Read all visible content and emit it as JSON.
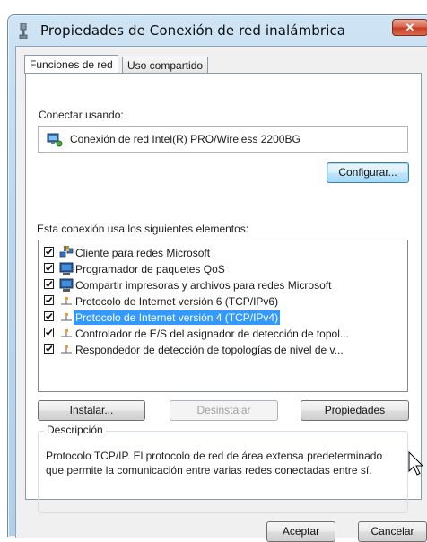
{
  "window": {
    "title": "Propiedades de Conexión de red inalámbrica",
    "close_label": "✕"
  },
  "tabs": [
    {
      "label": "Funciones de red",
      "active": true
    },
    {
      "label": "Uso compartido",
      "active": false
    }
  ],
  "connect_using": {
    "label": "Conectar usando:",
    "adapter": "Conexión de red Intel(R) PRO/Wireless 2200BG",
    "configure_button": "Configurar..."
  },
  "components": {
    "label": "Esta conexión usa los siguientes elementos:",
    "items": [
      {
        "label": "Cliente para redes Microsoft",
        "checked": true,
        "icon": "network-client-icon",
        "selected": false
      },
      {
        "label": "Programador de paquetes QoS",
        "checked": true,
        "icon": "computer-service-icon",
        "selected": false
      },
      {
        "label": "Compartir impresoras y archivos para redes Microsoft",
        "checked": true,
        "icon": "computer-service-icon",
        "selected": false
      },
      {
        "label": "Protocolo de Internet versión 6 (TCP/IPv6)",
        "checked": true,
        "icon": "protocol-icon",
        "selected": false
      },
      {
        "label": "Protocolo de Internet versión 4 (TCP/IPv4)",
        "checked": true,
        "icon": "protocol-icon",
        "selected": true
      },
      {
        "label": "Controlador de E/S del asignador de detección de topol...",
        "checked": true,
        "icon": "protocol-icon",
        "selected": false
      },
      {
        "label": "Respondedor de detección de topologías de nivel de v...",
        "checked": true,
        "icon": "protocol-icon",
        "selected": false
      }
    ]
  },
  "actions": {
    "install": "Instalar...",
    "uninstall": "Desinstalar",
    "properties": "Propiedades"
  },
  "description": {
    "legend": "Descripción",
    "text": "Protocolo TCP/IP. El protocolo de red de área extensa predeterminado que permite la comunicación entre varias redes conectadas entre sí."
  },
  "footer": {
    "ok": "Aceptar",
    "cancel": "Cancelar"
  },
  "colors": {
    "selection": "#3399ff",
    "close_button": "#c33c20",
    "title_glass": "#bcd7ee"
  }
}
